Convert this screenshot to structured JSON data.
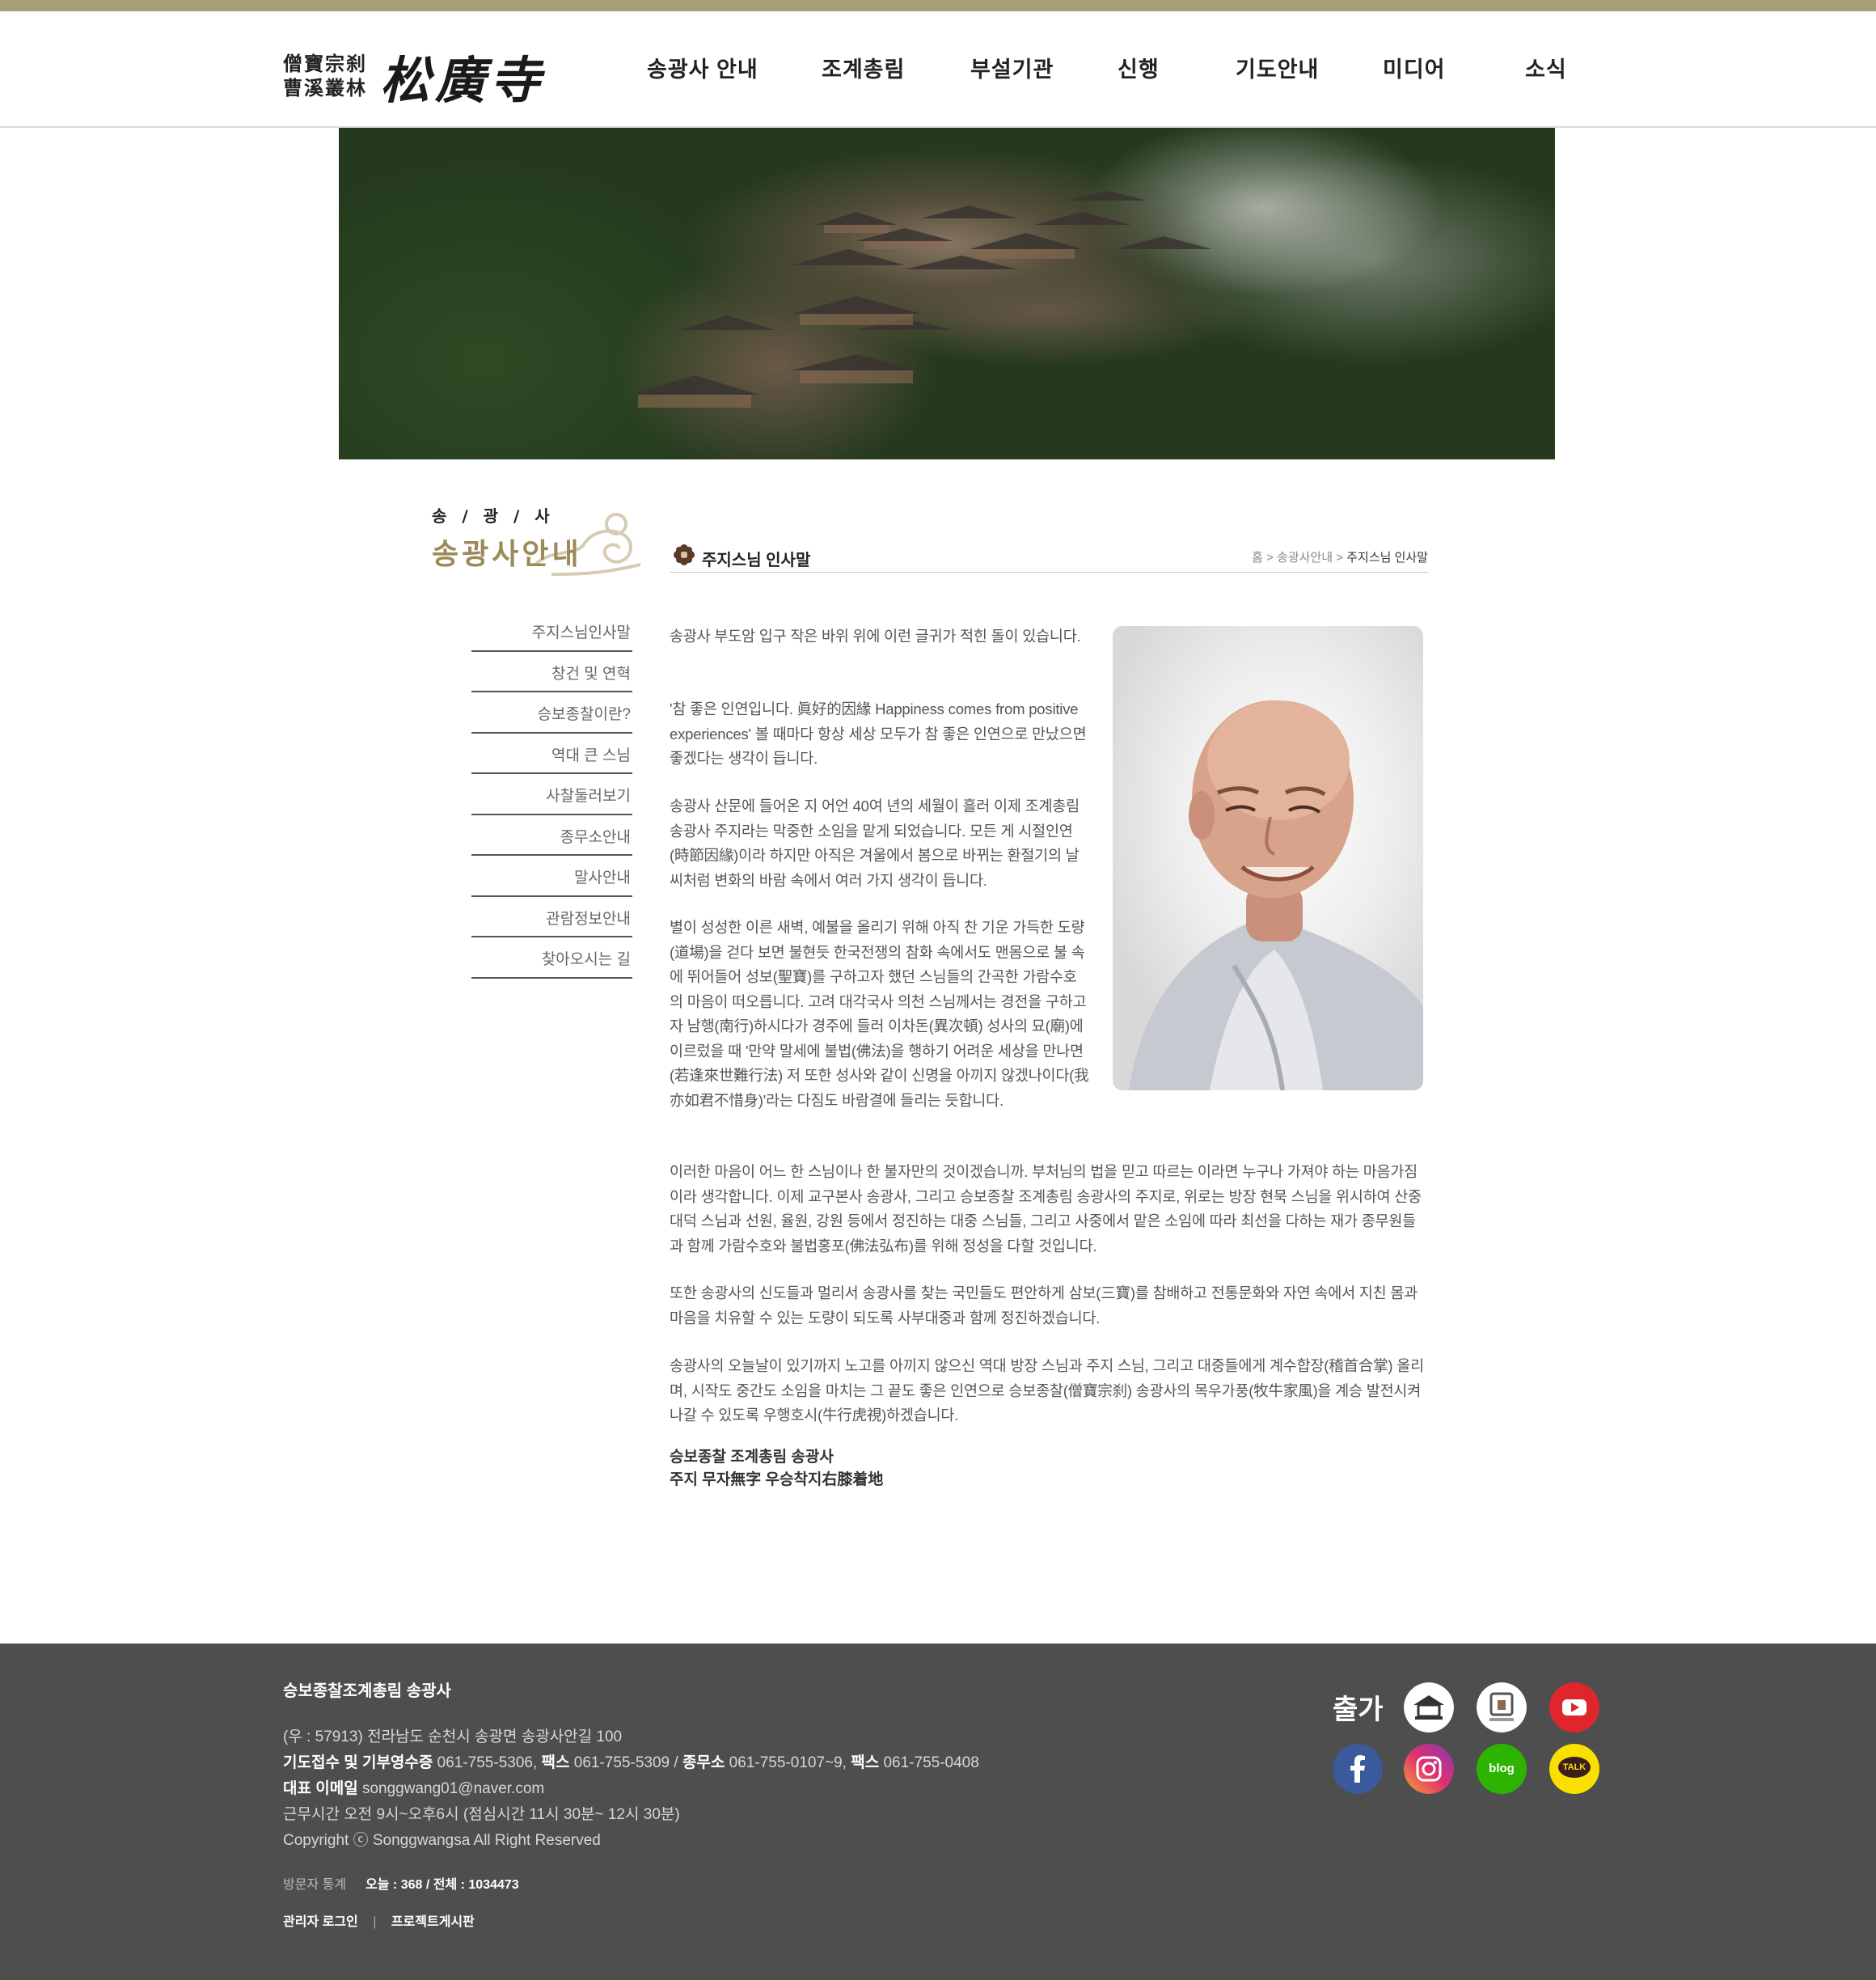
{
  "header": {
    "logo_small_line1": "僧寶宗刹",
    "logo_small_line2": "曹溪叢林",
    "logo_big": "松廣寺",
    "nav": [
      "송광사 안내",
      "조계총림",
      "부설기관",
      "신행",
      "기도안내",
      "미디어",
      "소식"
    ]
  },
  "sidebar": {
    "title_small": "송 / 광 / 사",
    "title_big": "송광사안내",
    "items": [
      "주지스님인사말",
      "창건 및 연혁",
      "승보종찰이란?",
      "역대 큰 스님",
      "사찰둘러보기",
      "종무소안내",
      "말사안내",
      "관람정보안내",
      "찾아오시는 길"
    ]
  },
  "content": {
    "title": "주지스님 인사말",
    "breadcrumb": [
      "홈",
      "송광사안내",
      "주지스님 인사말"
    ],
    "paragraphs": [
      "송광사 부도암 입구 작은 바위 위에 이런 글귀가 적힌 돌이 있습니다.",
      "'참 좋은 인연입니다. 眞好的因緣 Happiness comes from positive experiences' 볼 때마다 항상 세상 모두가 참 좋은 인연으로 만났으면 좋겠다는 생각이 듭니다.",
      "송광사 산문에 들어온 지 어언 40여 년의 세월이 흘러 이제 조계총림 송광사 주지라는 막중한 소임을 맡게 되었습니다. 모든 게 시절인연(時節因緣)이라 하지만 아직은 겨울에서 봄으로 바뀌는 환절기의 날씨처럼 변화의 바람 속에서 여러 가지 생각이 듭니다.",
      "별이 성성한 이른 새벽, 예불을 올리기 위해 아직 찬 기운 가득한 도량(道場)을 걷다 보면 불현듯 한국전쟁의 참화 속에서도 맨몸으로 불 속에 뛰어들어 성보(聖寶)를 구하고자 했던 스님들의 간곡한 가람수호의 마음이 떠오릅니다. 고려 대각국사 의천 스님께서는 경전을 구하고자 남행(南行)하시다가 경주에 들러 이차돈(異次頓) 성사의 묘(廟)에 이르렀을 때 '만약 말세에 불법(佛法)을 행하기 어려운 세상을 만나면(若逢來世難行法) 저 또한 성사와 같이 신명을 아끼지 않겠나이다(我亦如君不惜身)'라는 다짐도 바람결에 들리는 듯합니다.",
      "이러한 마음이 어느 한 스님이나 한 불자만의 것이겠습니까. 부처님의 법을 믿고 따르는 이라면 누구나 가져야 하는 마음가짐이라 생각합니다. 이제 교구본사 송광사, 그리고 승보종찰 조계총림 송광사의 주지로, 위로는 방장 현묵 스님을 위시하여 산중 대덕 스님과 선원, 율원, 강원 등에서 정진하는 대중 스님들, 그리고 사중에서 맡은 소임에 따라 최선을 다하는 재가 종무원들과 함께 가람수호와 불법홍포(佛法弘布)를 위해 정성을 다할 것입니다.",
      "또한 송광사의 신도들과 멀리서 송광사를 찾는 국민들도 편안하게 삼보(三寶)를 참배하고 전통문화와 자연 속에서 지친 몸과 마음을 치유할 수 있는 도량이 되도록 사부대중과 함께 정진하겠습니다.",
      "송광사의 오늘날이 있기까지 노고를 아끼지 않으신 역대 방장 스님과 주지 스님, 그리고 대중들에게 계수합장(稽首合掌) 올리며, 시작도 중간도 소임을 마치는 그 끝도 좋은 인연으로 승보종찰(僧寶宗刹) 송광사의 목우가풍(牧牛家風)을 계승 발전시켜 나갈 수 있도록 우행호시(牛行虎視)하겠습니다."
    ],
    "sign_line1": "승보종찰 조계총림 송광사",
    "sign_line2": "주지 무자無字 우승착지右膝着地"
  },
  "footer": {
    "org": "승보종찰조계총림 송광사",
    "address": "(우 : 57913) 전라남도 순천시 송광면 송광사안길 100",
    "prayer_label": "기도접수 및 기부영수증",
    "prayer_tel": " 061-755-5306, ",
    "fax_label": "팩스",
    "fax1": " 061-755-5309 / ",
    "office_label": "종무소",
    "office_tel": " 061-755-0107~9, ",
    "fax2_label": "팩스",
    "fax2": " 061-755-0408",
    "email_label": "대표 이메일",
    "email": " songgwang01@naver.com",
    "hours": "근무시간 오전 9시~오후6시 (점심시간 11시 30분~ 12시 30분)",
    "copyright": "Copyright ⓒ Songgwangsa All Right Reserved",
    "stats_label": "방문자 통계",
    "stats_value": "오늘 : 368 / 전체 : 1034473",
    "admin_login": "관리자 로그인",
    "separator": "|",
    "project_board": "프로젝트게시판",
    "social_label": "출가",
    "social_icons": [
      "temple-icon",
      "templestay-icon",
      "youtube-icon",
      "facebook-icon",
      "instagram-icon",
      "blog-icon",
      "kakaotalk-icon"
    ],
    "blog_text": "blog",
    "talk_text": "TALK"
  },
  "colors": {
    "topbar": "#a59f77",
    "footer_bg": "#4e4e4e",
    "accent_gold": "#9c8a5a"
  }
}
